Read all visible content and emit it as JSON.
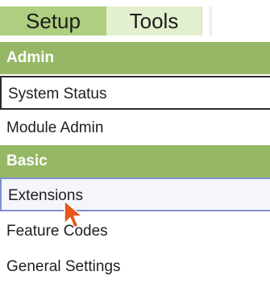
{
  "tabs": [
    {
      "label": "Setup"
    },
    {
      "label": "Tools"
    }
  ],
  "sections": [
    {
      "header": "Admin",
      "items": [
        {
          "label": "System Status"
        },
        {
          "label": "Module Admin"
        }
      ]
    },
    {
      "header": "Basic",
      "items": [
        {
          "label": "Extensions"
        },
        {
          "label": "Feature Codes"
        },
        {
          "label": "General Settings"
        }
      ]
    }
  ],
  "colors": {
    "tab_active": "#aecf7f",
    "tab_inactive": "#e3f0cf",
    "section_header": "#96b866",
    "cursor": "#e8561c"
  },
  "icons": {
    "cursor": "mouse-pointer-icon"
  }
}
